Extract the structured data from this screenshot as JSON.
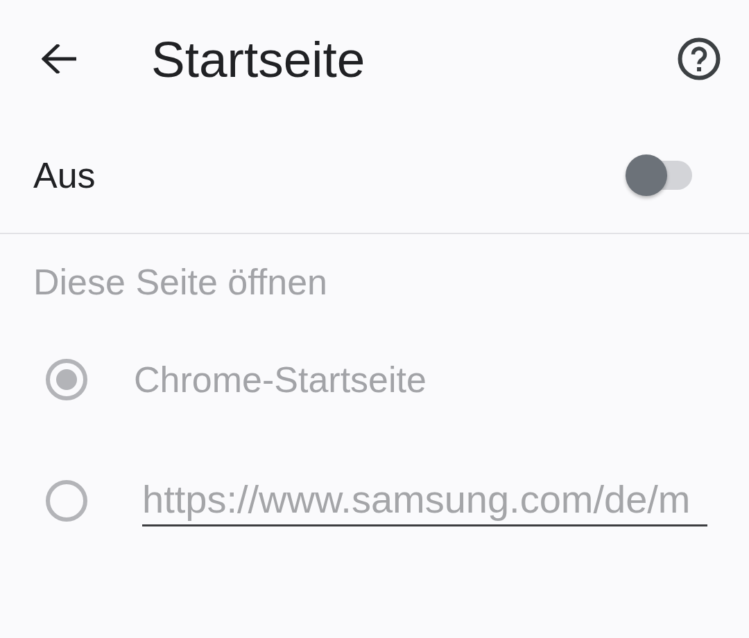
{
  "header": {
    "title": "Startseite"
  },
  "home_toggle": {
    "label": "Aus",
    "on": false
  },
  "open_section": {
    "heading": "Diese Seite öffnen",
    "disabled": true,
    "options": [
      {
        "kind": "label",
        "label": "Chrome-Startseite",
        "selected": true
      },
      {
        "kind": "input",
        "value": "https://www.samsung.com/de/m",
        "selected": false
      }
    ]
  }
}
